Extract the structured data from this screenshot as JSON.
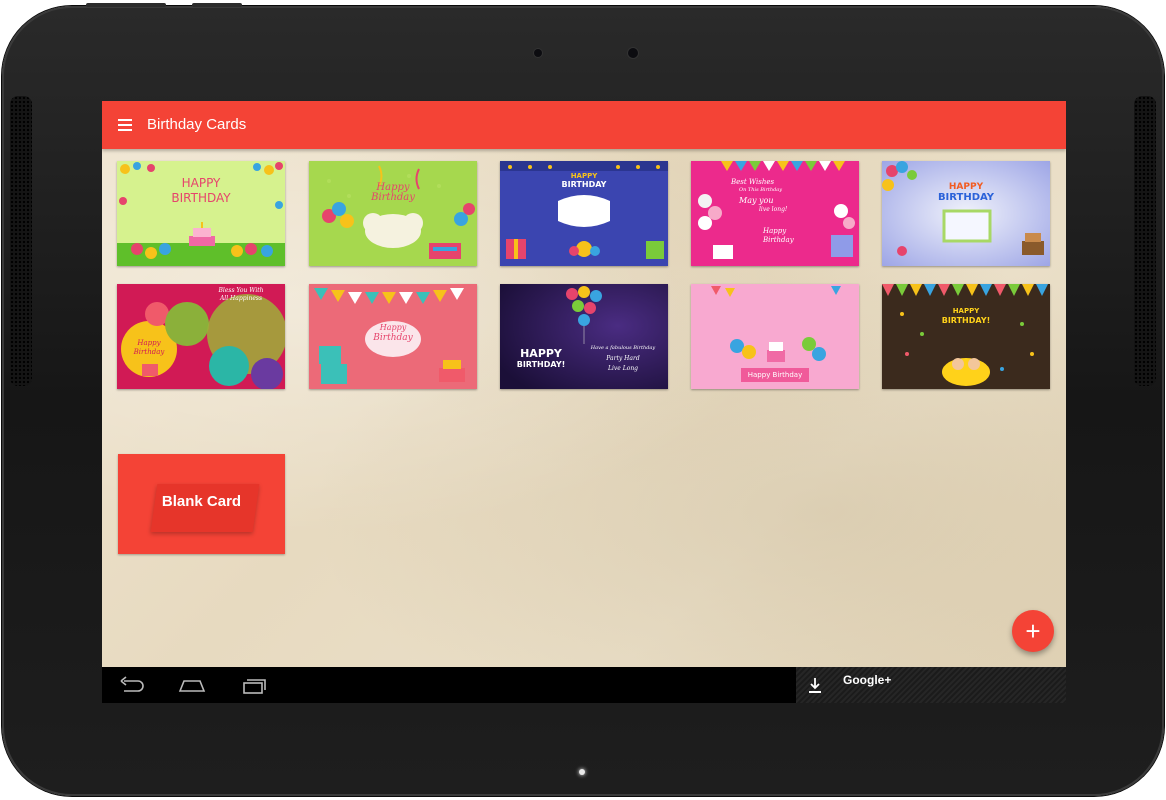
{
  "app": {
    "title": "Birthday Cards",
    "accent_color": "#f44336",
    "menu_icon": "hamburger-menu-icon"
  },
  "cards": [
    {
      "id": "card-1",
      "lines": [
        "HAPPY",
        "BIRTHDAY"
      ],
      "palette": [
        "#c9ef7a",
        "#e6446c"
      ]
    },
    {
      "id": "card-2",
      "lines": [
        "Happy",
        "Birthday"
      ],
      "palette": [
        "#9bd24a",
        "#e6446c"
      ]
    },
    {
      "id": "card-3",
      "lines": [
        "HAPPY",
        "BIRTHDAY"
      ],
      "palette": [
        "#3f48b4",
        "#ffffff"
      ]
    },
    {
      "id": "card-4",
      "lines": [
        "Best Wishes",
        "On This Birthday",
        "May you",
        "live long!",
        "Happy",
        "Birthday"
      ],
      "palette": [
        "#ec2a8c",
        "#ffffff"
      ]
    },
    {
      "id": "card-5",
      "lines": [
        "HAPPY",
        "BIRTHDAY"
      ],
      "palette": [
        "#b9c6ef",
        "#f25b20"
      ]
    },
    {
      "id": "card-6",
      "lines": [
        "Bless You With",
        "All Happiness",
        "Happy",
        "Birthday"
      ],
      "palette": [
        "#d11a55",
        "#ffffff"
      ]
    },
    {
      "id": "card-7",
      "lines": [
        "Happy",
        "Birthday"
      ],
      "palette": [
        "#ec6a78",
        "#ffffff"
      ]
    },
    {
      "id": "card-8",
      "lines": [
        "HAPPY",
        "BIRTHDAY!",
        "Have a fabulous Birthday",
        "Party Hard",
        "Live Long"
      ],
      "palette": [
        "#2b1750",
        "#ffffff"
      ]
    },
    {
      "id": "card-9",
      "lines": [
        "Happy Birthday"
      ],
      "palette": [
        "#f8a9d0",
        "#ffffff"
      ]
    },
    {
      "id": "card-10",
      "lines": [
        "HAPPY",
        "BIRTHDAY!"
      ],
      "palette": [
        "#3b2a1d",
        "#ffd21a"
      ]
    }
  ],
  "blank_card": {
    "label": "Blank Card",
    "color": "#f44336"
  },
  "fab": {
    "icon": "plus-icon",
    "glyph": "+"
  },
  "system_nav": {
    "back": "back-icon",
    "home": "home-icon",
    "recents": "recents-icon"
  },
  "notification": {
    "icon": "download-icon",
    "text": "Google+"
  }
}
